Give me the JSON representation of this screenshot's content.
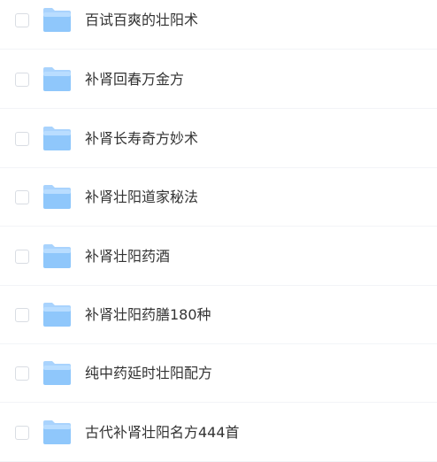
{
  "file_list": {
    "items": [
      {
        "name": "百试百爽的壮阳术",
        "icon": "folder-icon",
        "checked": false
      },
      {
        "name": "补肾回春万金方",
        "icon": "folder-icon",
        "checked": false
      },
      {
        "name": "补肾长寿奇方妙术",
        "icon": "folder-icon",
        "checked": false
      },
      {
        "name": "补肾壮阳道家秘法",
        "icon": "folder-icon",
        "checked": false
      },
      {
        "name": "补肾壮阳药酒",
        "icon": "folder-icon",
        "checked": false
      },
      {
        "name": "补肾壮阳药膳180种",
        "icon": "folder-icon",
        "checked": false
      },
      {
        "name": "纯中药延时壮阳配方",
        "icon": "folder-icon",
        "checked": false
      },
      {
        "name": "古代补肾壮阳名方444首",
        "icon": "folder-icon",
        "checked": false
      }
    ]
  },
  "colors": {
    "folder_light": "#bfe0ff",
    "folder_main": "#8fc7fb",
    "folder_dark": "#6fb2f2",
    "text": "#333333",
    "checkbox_border": "#d9dde3",
    "divider": "#f2f4f7"
  }
}
